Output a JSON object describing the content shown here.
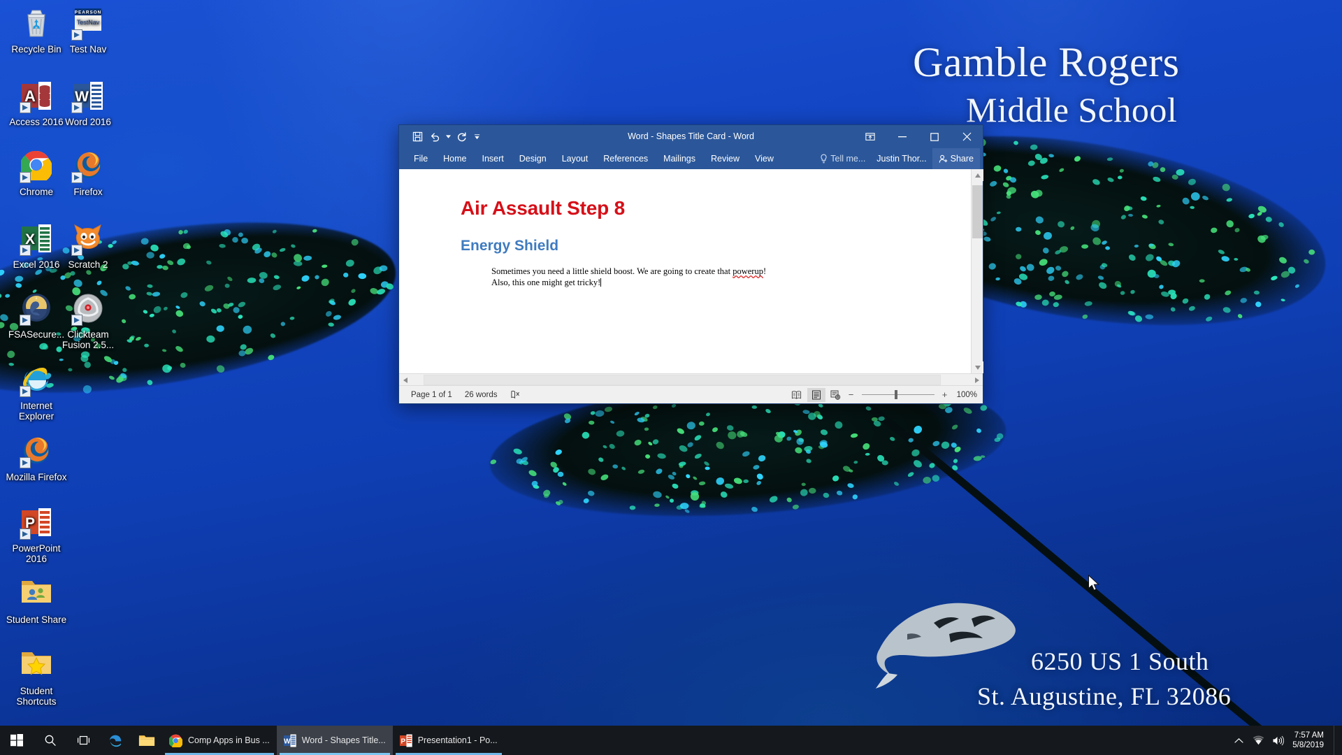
{
  "desktop": {
    "wallpaper": {
      "school_line1": "Gamble Rogers",
      "school_line2": "Middle School",
      "address_line1": "6250 US 1 South",
      "address_line2": "St. Augustine, FL 32086",
      "background_color": "#0f3fb5"
    },
    "icons": [
      {
        "label": "Recycle Bin",
        "icon": "recycle-bin-icon",
        "shortcut": false
      },
      {
        "label": "Test Nav",
        "icon": "testnav-icon",
        "shortcut": true,
        "brand": "PEARSON",
        "brand_sub": "TestNav"
      },
      {
        "label": "Access 2016",
        "icon": "access-icon",
        "shortcut": true,
        "letter": "A",
        "color": "#a4373a"
      },
      {
        "label": "Word 2016",
        "icon": "word-icon",
        "shortcut": true,
        "letter": "W",
        "color": "#2b579a"
      },
      {
        "label": "Chrome",
        "icon": "chrome-icon",
        "shortcut": true
      },
      {
        "label": "Firefox",
        "icon": "firefox-icon",
        "shortcut": true
      },
      {
        "label": "Excel 2016",
        "icon": "excel-icon",
        "shortcut": true,
        "letter": "X",
        "color": "#217346"
      },
      {
        "label": "Scratch 2",
        "icon": "scratch-cat-icon",
        "shortcut": true
      },
      {
        "label": "FSASecure...",
        "icon": "fsa-secure-icon",
        "shortcut": true
      },
      {
        "label": "Clickteam Fusion 2.5...",
        "icon": "clickteam-fusion-icon",
        "shortcut": true
      },
      {
        "label": "Internet Explorer",
        "icon": "internet-explorer-icon",
        "shortcut": true
      },
      {
        "label": "Mozilla Firefox",
        "icon": "firefox-icon",
        "shortcut": true
      },
      {
        "label": "PowerPoint 2016",
        "icon": "powerpoint-icon",
        "shortcut": true,
        "letter": "P",
        "color": "#d24726"
      },
      {
        "label": "Student Share",
        "icon": "folder-users-icon",
        "shortcut": false
      },
      {
        "label": "Student Shortcuts",
        "icon": "folder-star-icon",
        "shortcut": false
      }
    ]
  },
  "word": {
    "title": "Word - Shapes Title Card - Word",
    "quick_access": [
      {
        "name": "save-button",
        "glyph": "save-icon"
      },
      {
        "name": "undo-button",
        "glyph": "undo-icon"
      },
      {
        "name": "redo-button",
        "glyph": "redo-icon"
      },
      {
        "name": "customize-quick-access-button",
        "glyph": "chevron-down-icon"
      }
    ],
    "window_controls": {
      "ribbon_display_options": "ribbon-display-options-icon",
      "minimize": "minimize-icon",
      "maximize": "maximize-icon",
      "close": "close-icon"
    },
    "tabs": [
      {
        "label": "File",
        "active": false
      },
      {
        "label": "Home",
        "active": false
      },
      {
        "label": "Insert",
        "active": false
      },
      {
        "label": "Design",
        "active": false
      },
      {
        "label": "Layout",
        "active": false
      },
      {
        "label": "References",
        "active": false
      },
      {
        "label": "Mailings",
        "active": false
      },
      {
        "label": "Review",
        "active": false
      },
      {
        "label": "View",
        "active": false
      }
    ],
    "tell_me": "Tell me...",
    "account_name": "Justin Thor...",
    "share_label": "Share",
    "document": {
      "heading1": "Air Assault Step 8",
      "heading1_color": "#d60f18",
      "heading2": "Energy Shield",
      "heading2_color": "#3f7bbf",
      "paragraph_line1_a": "Sometimes you need a little shield boost.  We are going to create that ",
      "paragraph_line1_misspelled": "powerup",
      "paragraph_line1_b": "!",
      "paragraph_line2": "Also, this one might get tricky!"
    },
    "status_bar": {
      "page": "Page 1 of 1",
      "words": "26 words",
      "proofing_icon": "proofing-errors-icon",
      "views": [
        {
          "name": "read-mode-view-button",
          "icon": "read-mode-icon",
          "active": false
        },
        {
          "name": "print-layout-view-button",
          "icon": "print-layout-icon",
          "active": true
        },
        {
          "name": "web-layout-view-button",
          "icon": "web-layout-icon",
          "active": false
        }
      ],
      "zoom_out": "−",
      "zoom_in": "+",
      "zoom_level": "100%"
    }
  },
  "taskbar": {
    "start": "start-button",
    "search": "search-icon",
    "task_view": "task-view-icon",
    "pinned": [
      {
        "label": "",
        "icon": "edge-icon"
      },
      {
        "label": "",
        "icon": "file-explorer-icon"
      }
    ],
    "apps": [
      {
        "label": "Comp Apps in Bus ...",
        "icon": "chrome-icon",
        "active": false
      },
      {
        "label": "Word - Shapes Title...",
        "icon": "word-icon",
        "active": true
      },
      {
        "label": "Presentation1 - Po...",
        "icon": "powerpoint-icon",
        "active": false
      }
    ],
    "tray": [
      {
        "name": "show-hidden-icons-button",
        "icon": "chevron-up-icon"
      },
      {
        "name": "network-icon",
        "icon": "wifi-icon"
      },
      {
        "name": "volume-icon",
        "icon": "speaker-icon"
      }
    ],
    "clock": {
      "time": "7:57 AM",
      "date": "5/8/2019"
    }
  }
}
